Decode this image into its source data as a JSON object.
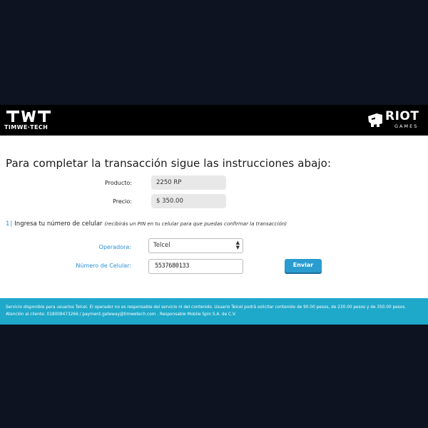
{
  "header": {
    "left_logo": {
      "mark": "TWT",
      "subtitle": "TIMWE·TECH"
    },
    "right_logo": {
      "name": "RIOT",
      "subtitle": "GAMES"
    }
  },
  "main": {
    "title": "Para completar la transacción sigue las instrucciones abajo:",
    "product": {
      "label": "Producto:",
      "value": "2250 RP"
    },
    "price": {
      "label": "Precio:",
      "value": "$ 350.00"
    },
    "step": {
      "number": "1",
      "separator": "|",
      "text": "Ingresa tu número de celular",
      "hint": "(recibirás un PIN en tu celular para que puedas confirmar la transacción)"
    },
    "operator": {
      "label": "Operadora:",
      "selected": "Telcel"
    },
    "phone": {
      "label": "Número de Celular:",
      "value": "5537680133"
    },
    "submit_label": "Enviar"
  },
  "footer": {
    "text": "Servicio disponible para usuarios Telcel. El operador no es responsable del servicio ni del contenido. Usuario Telcel podrá solicitar contenido de 90.00 pesos, de 230.00 pesos y de 350.00 pesos. Atención al cliente: 018008473266 / payment.gateway@timwetech.com . Responsable Mobile Spin S.A. de C.V."
  },
  "colors": {
    "accent": "#2a8fd6",
    "button": "#2a9ccf",
    "footer_bg": "#1ea8c9",
    "header_bg": "#000000",
    "page_bg": "#0d1320"
  }
}
